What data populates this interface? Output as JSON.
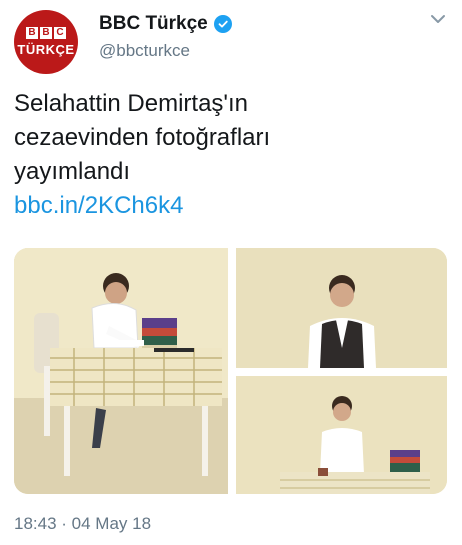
{
  "account": {
    "avatar_logo_text": "BBC",
    "avatar_logo_letters": [
      "B",
      "B",
      "C"
    ],
    "avatar_sub": "TÜRKÇE",
    "display_name": "BBC Türkçe",
    "handle": "@bbcturkce",
    "verified_icon": "verified-badge-icon"
  },
  "tweet": {
    "text_lines": [
      "Selahattin Demirtaş'ın",
      "cezaevinden fotoğrafları",
      "yayımlandı"
    ],
    "link": "bbc.in/2KCh6k4",
    "timestamp": "18:43 · 04 May 18"
  },
  "menu_icon": "chevron-down-icon",
  "colors": {
    "brand_red": "#bb1919",
    "link_blue": "#1b95e0",
    "verified_blue": "#1da1f2",
    "secondary_text": "#657786"
  }
}
